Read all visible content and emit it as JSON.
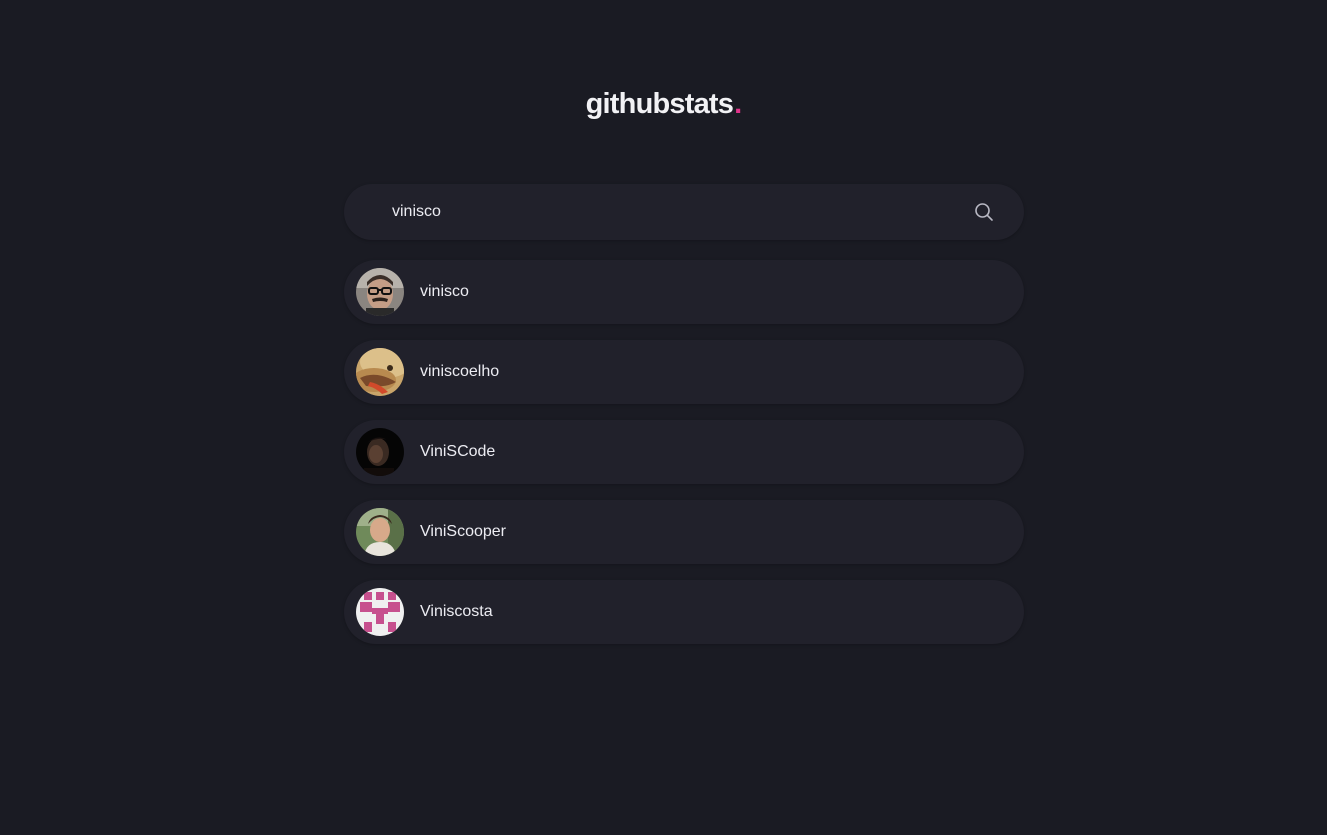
{
  "header": {
    "logo_text": "githubstats",
    "logo_dot": "."
  },
  "search": {
    "value": "vinisco",
    "icon": "search-icon"
  },
  "results": [
    {
      "username": "vinisco",
      "avatar": "photo-man-glasses-mustache"
    },
    {
      "username": "viniscoelho",
      "avatar": "photo-cartoon-dinosaur"
    },
    {
      "username": "ViniSCode",
      "avatar": "photo-dark-portrait"
    },
    {
      "username": "ViniScooper",
      "avatar": "photo-young-man-outdoors"
    },
    {
      "username": "Viniscosta",
      "avatar": "identicon-pink"
    }
  ],
  "colors": {
    "background": "#1a1b23",
    "card": "#21212b",
    "accent": "#e0338a",
    "text": "#ececf2"
  }
}
